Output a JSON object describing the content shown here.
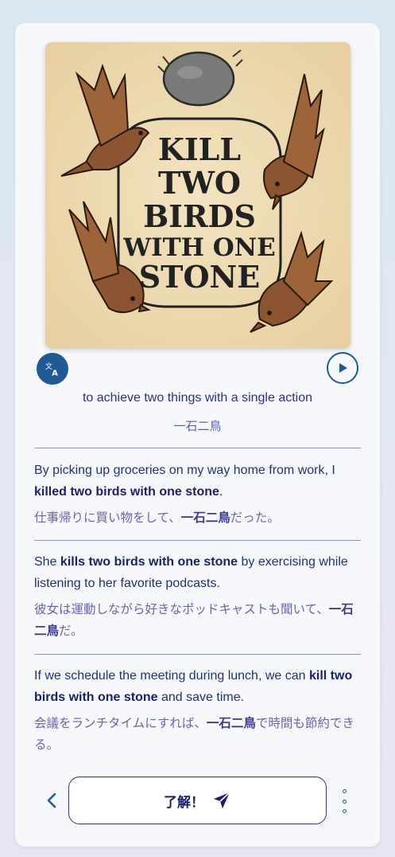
{
  "illustration": {
    "title_lines": [
      "KILL",
      "TWO",
      "BIRDS",
      "WITH ONE",
      "STONE"
    ]
  },
  "meaning": {
    "en": "to achieve two things with a single action",
    "ja": "一石二鳥"
  },
  "examples": [
    {
      "en_before": "By picking up groceries on my way home from work, I ",
      "en_bold": "killed two birds with one stone",
      "en_after": ".",
      "ja_before": "仕事帰りに買い物をして、",
      "ja_bold": "一石二鳥",
      "ja_after": "だった。"
    },
    {
      "en_before": "She ",
      "en_bold": "kills two birds with one stone",
      "en_after": " by exercising while listening to her favorite podcasts.",
      "ja_before": "彼女は運動しながら好きなポッドキャストも聞いて、",
      "ja_bold": "一石二鳥",
      "ja_after": "だ。"
    },
    {
      "en_before": "If we schedule the meeting during lunch, we can ",
      "en_bold": "kill two birds with one stone",
      "en_after": " and save time.",
      "ja_before": "会議をランチタイムにすれば、",
      "ja_bold": "一石二鳥",
      "ja_after": "で時間も節約できる。"
    }
  ],
  "footer": {
    "ok_label": "了解！"
  },
  "icons": {
    "translate": "translate-icon",
    "play": "play-icon",
    "back": "chevron-left-icon",
    "send": "send-icon",
    "more": "more-vertical-icon"
  },
  "colors": {
    "accent": "#1f5a96",
    "text": "#2a3190",
    "ja_text": "#6b63b8",
    "illustration_bg": "#efdcb4"
  }
}
